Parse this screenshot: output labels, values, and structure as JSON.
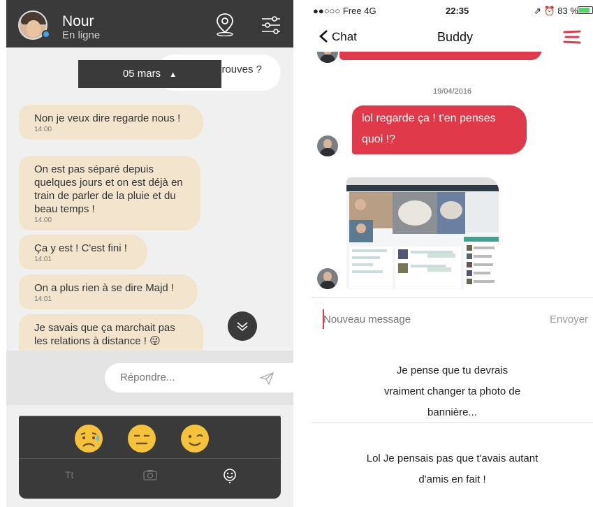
{
  "left": {
    "contact": {
      "name": "Nour",
      "presence": "En ligne"
    },
    "header_icons": {
      "location": "location-pin-icon",
      "settings": "sliders-icon"
    },
    "partial_bubble": {
      "text": "trouves ?"
    },
    "date_pill": {
      "label": "05 mars",
      "icon": "caret-up-icon"
    },
    "messages": [
      {
        "text": "Non je veux dire regarde nous !",
        "time": "14:00"
      },
      {
        "text": "On est pas séparé depuis quelques jours et on est déjà en train de parler de la pluie et du beau temps !",
        "time": "14:00"
      },
      {
        "text": "Ça y est ! C'est fini !",
        "time": "14:01"
      },
      {
        "text": "On a plus rien à se dire Majd !",
        "time": "14:01"
      },
      {
        "text": "Je savais que ça marchait pas les relations à distance ! 😜",
        "time": ""
      }
    ],
    "reply": {
      "placeholder": "Répondre..."
    },
    "emojis": [
      "😥",
      "😑",
      "😉"
    ],
    "tools": {
      "text": "Tt",
      "camera": "camera-icon",
      "emoji": "smiley-icon"
    },
    "colors": {
      "header": "#3a3a3a",
      "bubble": "#f3e5cd"
    }
  },
  "right": {
    "status": {
      "carrier": "●●○○○ Free  4G",
      "time": "22:35",
      "right": "⇗ ⏰ 83 %"
    },
    "battery_level": 0.83,
    "nav": {
      "back": "Chat",
      "title": "Buddy"
    },
    "date": "19/04/2016",
    "message": "lol regarde ça ! t'en penses quoi !?",
    "compose": {
      "placeholder": "Nouveau message",
      "send": "Envoyer"
    },
    "captions": [
      "Je pense que tu devrais vraiment changer ta photo de bannière...",
      "Lol Je pensais pas que t'avais autant d'amis en fait !"
    ],
    "colors": {
      "accent": "#e03a4a"
    }
  }
}
